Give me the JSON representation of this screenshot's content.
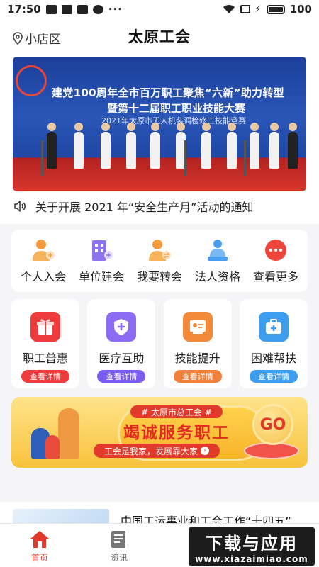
{
  "status_bar": {
    "time": "17:50",
    "battery": "100"
  },
  "header": {
    "location": "小店区",
    "title": "太原工会"
  },
  "banner": {
    "title_line1": "建党100周年全市百万职工聚焦“六新”助力转型",
    "title_line2": "暨第十二届职工职业技能大赛",
    "subtitle": "2021年太原市无人机装调检修工技能竞赛"
  },
  "notice": {
    "text": "关于开展 2021 年“安全生产月”活动的通知"
  },
  "quick_actions": [
    {
      "label": "个人入会",
      "icon": "person-join-icon"
    },
    {
      "label": "单位建会",
      "icon": "building-icon"
    },
    {
      "label": "我要转会",
      "icon": "person-transfer-icon"
    },
    {
      "label": "法人资格",
      "icon": "legal-person-icon"
    },
    {
      "label": "查看更多",
      "icon": "more-icon"
    }
  ],
  "services": [
    {
      "label": "职工普惠",
      "button": "查看详情",
      "color": "#ef3b3b",
      "icon": "gift-icon"
    },
    {
      "label": "医疗互助",
      "button": "查看详情",
      "color": "#7b5cf0",
      "icon": "medical-shield-icon"
    },
    {
      "label": "技能提升",
      "button": "查看详情",
      "color": "#f0803a",
      "icon": "skill-board-icon"
    },
    {
      "label": "困难帮扶",
      "button": "查看详情",
      "color": "#3d9ef0",
      "icon": "first-aid-kit-icon"
    }
  ],
  "promo": {
    "tag": "# 太原市总工会 #",
    "title": "竭诚服务职工",
    "subtitle": "工会是我家，发展靠大家",
    "go": "GO"
  },
  "news": {
    "title": "中国工运事业和工会工作“十四五”发展规划"
  },
  "tabbar": {
    "items": [
      {
        "label": "首页",
        "active": true
      },
      {
        "label": "资讯",
        "active": false
      }
    ]
  },
  "watermark": {
    "main": "下载与应用",
    "url": "www.xiazaimiao.com"
  },
  "colors": {
    "accent": "#e23a2a",
    "background": "#f5f5f7"
  }
}
